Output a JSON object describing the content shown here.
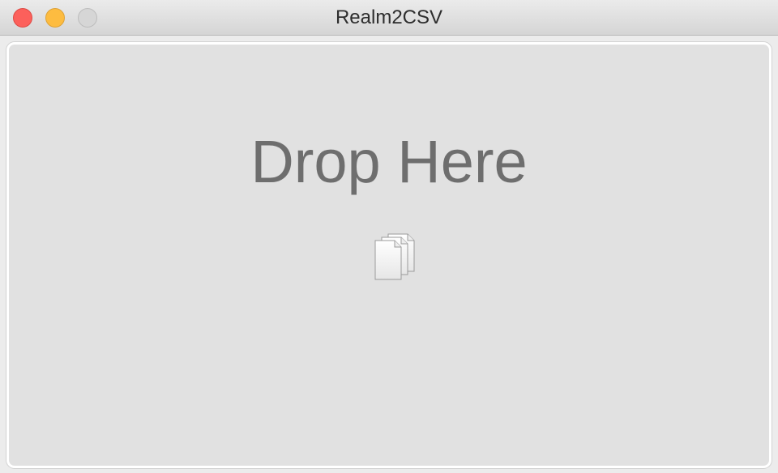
{
  "window": {
    "title": "Realm2CSV",
    "controls": {
      "close_color": "#fc605b",
      "minimize_color": "#fdbc40",
      "zoom_color": "#d6d6d6"
    }
  },
  "dropzone": {
    "label": "Drop Here",
    "icon": "multiple-documents-icon",
    "background": "#e1e1e1",
    "border_color": "#ffffff"
  }
}
